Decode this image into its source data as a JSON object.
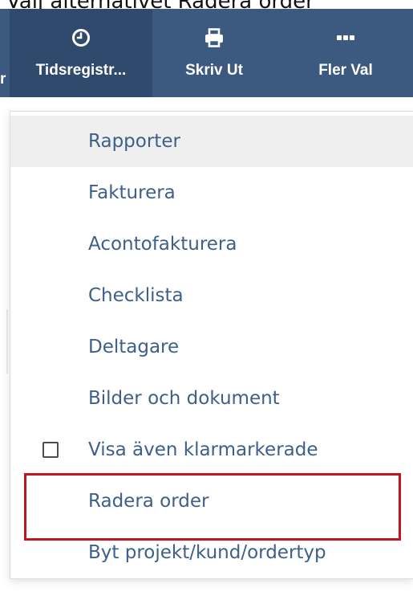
{
  "caption": "Välj alternativet Radera order",
  "toolbar": {
    "prev_label": "r",
    "items": [
      {
        "label": "Tidsregistr...",
        "icon": "clock-icon",
        "active": true
      },
      {
        "label": "Skriv Ut",
        "icon": "printer-icon",
        "active": false
      },
      {
        "label": "Fler Val",
        "icon": "more-dots-icon",
        "active": false
      }
    ],
    "background": "#3c5a80",
    "active_background": "#2f4a6d"
  },
  "menu": {
    "items": [
      {
        "label": "Rapporter",
        "hovered": true
      },
      {
        "label": "Fakturera"
      },
      {
        "label": "Acontofakturera"
      },
      {
        "label": "Checklista"
      },
      {
        "label": "Deltagare"
      },
      {
        "label": "Bilder och dokument"
      },
      {
        "label": "Visa även klarmarkerade",
        "checkbox": true,
        "checked": false
      },
      {
        "label": "Radera order",
        "highlighted": true
      },
      {
        "label": "Byt projekt/kund/ordertyp"
      }
    ],
    "text_color": "#3e5f8a",
    "highlight_color": "#c0161f"
  }
}
